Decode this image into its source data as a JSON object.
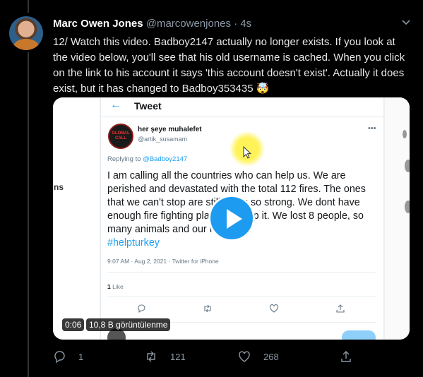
{
  "tweet": {
    "author_name": "Marc Owen Jones",
    "author_handle": "@marcowenjones",
    "separator": "·",
    "time": "4s",
    "text": "12/ Watch this video. Badboy2147 actually no longer exists. If you look at the video below, you'll see that his old username is cached. When you click on the link to his account it says 'this account doesn't exist'. Actually it does exist, but it has changed to Badboy353435 🤯"
  },
  "media": {
    "left_label": "ns",
    "screen_title": "Tweet",
    "embedded_post": {
      "avatar_text": "GLOBAL CALL",
      "author_name": "her şeye muhalefet",
      "author_handle": "@artik_susamam",
      "replying_to_label": "Replying to",
      "replying_to_handle": "@Badboy2147",
      "text": "I am calling all the countries who can help us. We are perished and devastated with the total 112 fires. The ones that we can't stop are still going so strong. We dont have enough fire fighting planes to stop it. We lost 8 people, so many animals and our forests.",
      "hashtag": "#helpturkey",
      "meta": "9:07 AM · Aug 2, 2021 · Twitter for iPhone",
      "likes_count": "1",
      "likes_label": "Like"
    },
    "duration": "0:06",
    "views": "10,8 B görüntülenme"
  },
  "actions": {
    "replies": "1",
    "retweets": "121",
    "likes": "268"
  },
  "colors": {
    "background": "#000000",
    "accent": "#1d9bf0",
    "muted": "#8b98a5"
  }
}
